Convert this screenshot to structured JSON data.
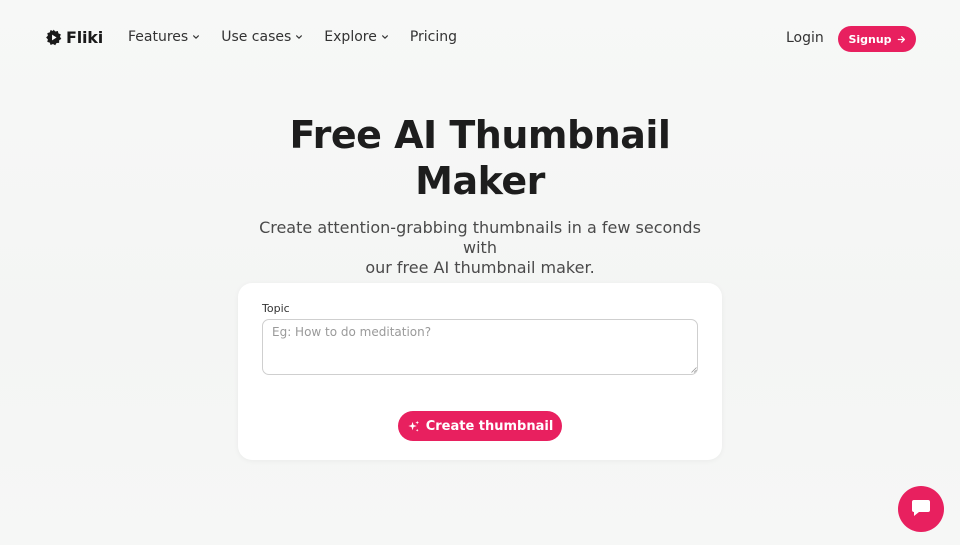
{
  "brand": {
    "name": "Fliki",
    "icon": "fliki-logo-icon"
  },
  "nav": {
    "items": [
      {
        "label": "Features",
        "has_dropdown": true
      },
      {
        "label": "Use cases",
        "has_dropdown": true
      },
      {
        "label": "Explore",
        "has_dropdown": true
      },
      {
        "label": "Pricing",
        "has_dropdown": false
      }
    ],
    "login_label": "Login",
    "signup_label": "Signup"
  },
  "hero": {
    "title_line1": "Free AI Thumbnail",
    "title_line2": "Maker",
    "subtitle_line1": "Create attention-grabbing thumbnails in a few seconds with",
    "subtitle_line2": "our free AI thumbnail maker."
  },
  "form": {
    "topic_label": "Topic",
    "topic_value": "",
    "topic_placeholder": "Eg: How to do meditation?",
    "submit_label": "Create thumbnail",
    "submit_icon": "sparkles-icon"
  },
  "chat": {
    "icon": "chat-bubble-icon"
  },
  "colors": {
    "accent": "#e8205f",
    "background": "#f4f5f4",
    "card": "#ffffff",
    "text_primary": "#1d1d1d",
    "text_secondary": "#4a4a4a"
  }
}
